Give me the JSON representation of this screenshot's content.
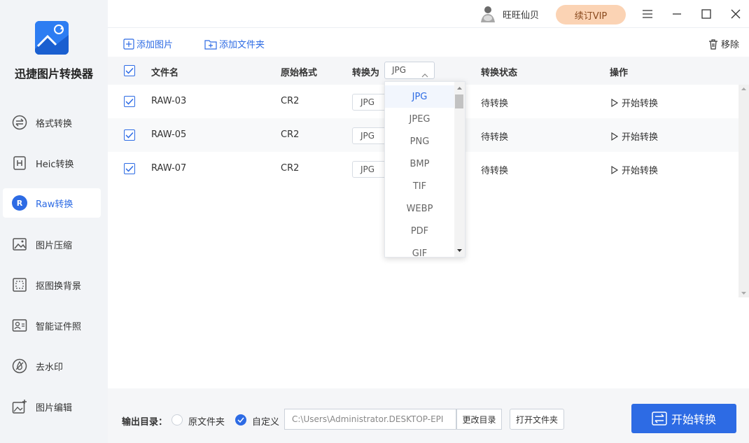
{
  "app": {
    "name": "迅捷图片转换器"
  },
  "sidebar": {
    "items": [
      {
        "label": "格式转换",
        "icon": "format-convert-icon"
      },
      {
        "label": "Heic转换",
        "icon": "heic-icon"
      },
      {
        "label": "Raw转换",
        "icon": "raw-icon",
        "active": true
      },
      {
        "label": "图片压缩",
        "icon": "image-compress-icon"
      },
      {
        "label": "抠图换背景",
        "icon": "cutout-icon"
      },
      {
        "label": "智能证件照",
        "icon": "id-photo-icon"
      },
      {
        "label": "去水印",
        "icon": "watermark-icon"
      },
      {
        "label": "图片编辑",
        "icon": "image-edit-icon"
      }
    ]
  },
  "titlebar": {
    "username": "旺旺仙贝",
    "vip_label": "续订VIP"
  },
  "toolbar": {
    "add_image": "添加图片",
    "add_folder": "添加文件夹",
    "remove": "移除"
  },
  "table": {
    "headers": {
      "filename": "文件名",
      "original_format": "原始格式",
      "convert_to": "转换为",
      "status": "转换状态",
      "action": "操作"
    },
    "header_format": "JPG",
    "rows": [
      {
        "name": "RAW-03",
        "format": "CR2",
        "target": "JPG",
        "status": "待转换",
        "action": "开始转换"
      },
      {
        "name": "RAW-05",
        "format": "CR2",
        "target": "JPG",
        "status": "待转换",
        "action": "开始转换"
      },
      {
        "name": "RAW-07",
        "format": "CR2",
        "target": "JPG",
        "status": "待转换",
        "action": "开始转换"
      }
    ]
  },
  "dropdown": {
    "options": [
      "JPG",
      "JPEG",
      "PNG",
      "BMP",
      "TIF",
      "WEBP",
      "PDF",
      "GIF"
    ],
    "selected": "JPG"
  },
  "footer": {
    "output_label": "输出目录：",
    "option_original": "原文件夹",
    "option_custom": "自定义",
    "path": "C:\\Users\\Administrator.DESKTOP-EPI",
    "change_dir": "更改目录",
    "open_folder": "打开文件夹",
    "convert": "开始转换"
  },
  "colors": {
    "accent": "#2d6be4",
    "vip_bg": "#fbd3b4"
  }
}
